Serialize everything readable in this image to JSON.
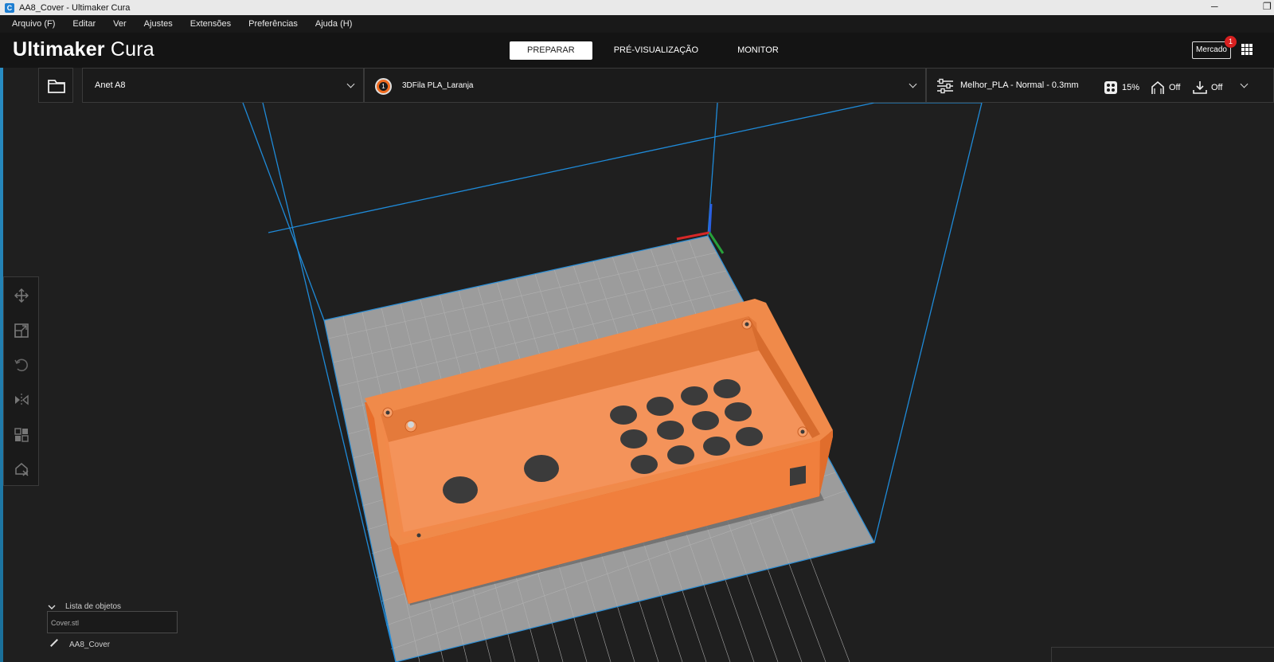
{
  "window": {
    "title": "AA8_Cover - Ultimaker Cura",
    "app_icon_letter": "C"
  },
  "menu": [
    "Arquivo (F)",
    "Editar",
    "Ver",
    "Ajustes",
    "Extensões",
    "Preferências",
    "Ajuda (H)"
  ],
  "header": {
    "logo_bold": "Ultimaker",
    "logo_light": "Cura",
    "tabs": [
      {
        "label": "PREPARAR",
        "active": true
      },
      {
        "label": "PRÉ-VISUALIZAÇÃO",
        "active": false
      },
      {
        "label": "MONITOR",
        "active": false
      }
    ],
    "marketplace_label": "Mercado",
    "marketplace_badge": "1"
  },
  "toolbar": {
    "printer": "Anet A8",
    "material": "3DFila PLA_Laranja",
    "extruder_number": "1",
    "profile": "Melhor_PLA - Normal - 0.3mm",
    "infill": "15%",
    "support": "Off",
    "adhesion": "Off"
  },
  "colors": {
    "accent": "#f0843f",
    "build_volume_lines": "#1f8ad8",
    "plate": "#9c9c9c",
    "background": "#1f1f1f"
  },
  "tools": [
    "move-icon",
    "scale-icon",
    "rotate-icon",
    "mirror-icon",
    "per-model-settings-icon",
    "support-blocker-icon"
  ],
  "object_list": {
    "header": "Lista de objetos",
    "items": [
      "Cover.stl"
    ],
    "job_name": "AA8_Cover"
  }
}
